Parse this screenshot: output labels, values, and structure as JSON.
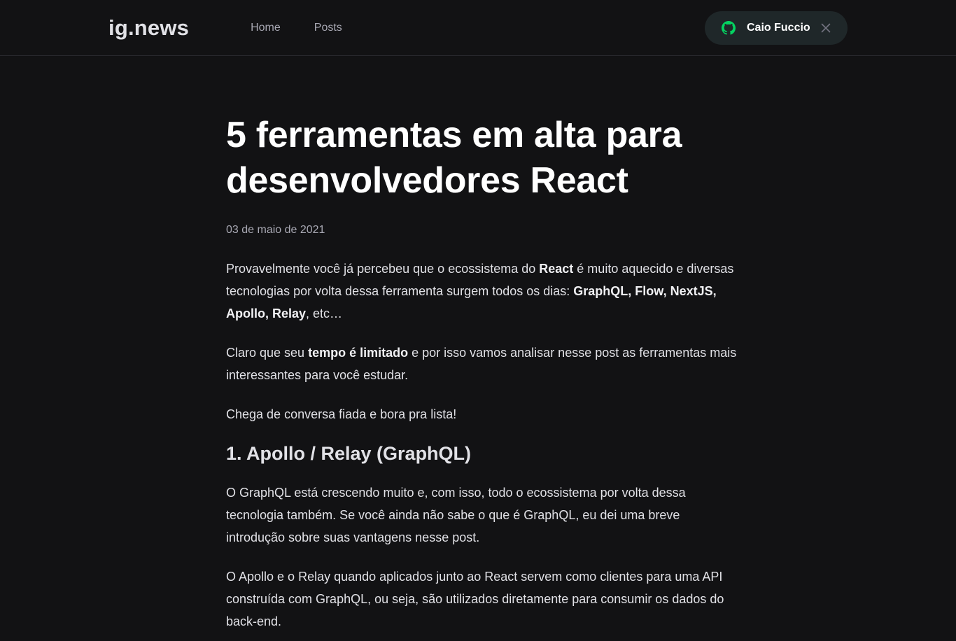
{
  "header": {
    "logo": "ig.news",
    "nav": [
      {
        "label": "Home"
      },
      {
        "label": "Posts"
      }
    ],
    "user": {
      "name": "Caio Fuccio",
      "icon": "github-icon",
      "icon_color": "#04d361",
      "close_icon": "close-icon"
    }
  },
  "post": {
    "title": "5 ferramentas em alta para desenvolvedores React",
    "date": "03 de maio de 2021",
    "p1": {
      "t1": "Provavelmente você já percebeu que o ecossistema do ",
      "b1": "React",
      "t2": " é muito aquecido e diversas tecnologias por volta dessa ferramenta surgem todos os dias: ",
      "b2": "GraphQL, Flow, NextJS, Apollo, Relay",
      "t3": ", etc…"
    },
    "p2": {
      "t1": "Claro que seu ",
      "b1": "tempo é limitado",
      "t2": " e por isso vamos analisar nesse post as ferramentas mais interessantes para você estudar."
    },
    "p3": "Chega de conversa fiada e bora pra lista!",
    "h2": "1. Apollo / Relay (GraphQL)",
    "p4": "O GraphQL está crescendo muito e, com isso, todo o ecossistema por volta dessa tecnologia também. Se você ainda não sabe o que é GraphQL, eu dei uma breve introdução sobre suas vantagens nesse post.",
    "p5": "O Apollo e o Relay quando aplicados junto ao React servem como clientes para uma API construída com GraphQL, ou seja, são utilizados diretamente para consumir os dados do back-end."
  },
  "colors": {
    "background": "#121214",
    "accent": "#04d361",
    "text": "#e1e1e6",
    "muted": "#a8a8b3"
  }
}
